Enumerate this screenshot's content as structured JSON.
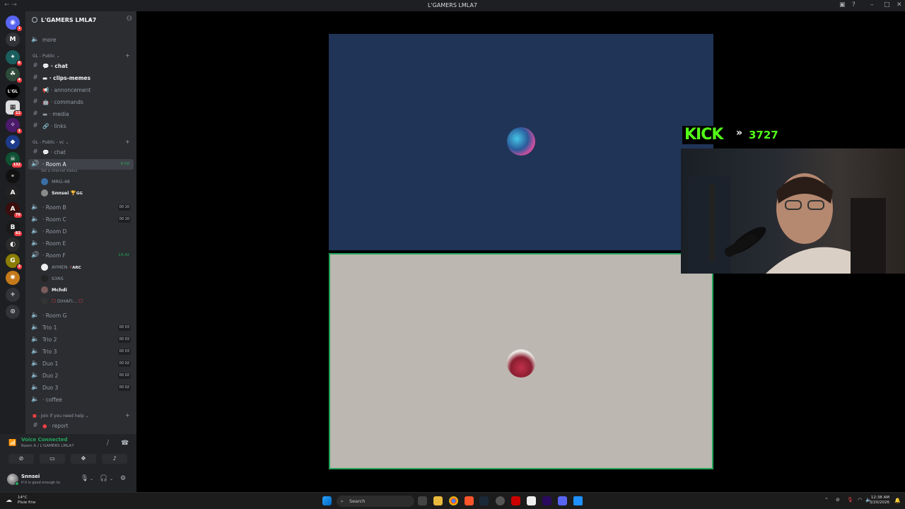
{
  "window": {
    "title": "L'GAMERS LMLA7"
  },
  "server": {
    "name": "L'GAMERS LMLA7"
  },
  "channels_top": [
    {
      "name": "more",
      "type": "voice"
    }
  ],
  "categories": [
    {
      "name": "GL - Public"
    },
    {
      "name": "GL - Public - vc"
    },
    {
      "name": "join if you need help"
    }
  ],
  "text_channels": [
    {
      "name": "chat",
      "emoji": "💬"
    },
    {
      "name": "clips-memes",
      "emoji": "▬"
    },
    {
      "name": "annoncement",
      "emoji": "📢"
    },
    {
      "name": "commands",
      "emoji": "🤖"
    },
    {
      "name": "media",
      "emoji": "▬"
    },
    {
      "name": "links",
      "emoji": "🔗"
    }
  ],
  "vc_channels": {
    "chat": "chat",
    "room_a": {
      "name": "Room A",
      "timer": "6:56",
      "status_hint": "Set a channel status"
    },
    "room_a_members": [
      {
        "name": "MRG-48"
      },
      {
        "name": "Snnsei",
        "tag": "GG"
      }
    ],
    "rooms": [
      {
        "name": "Room B",
        "count": "00 10"
      },
      {
        "name": "Room C",
        "count": "00 10"
      },
      {
        "name": "Room D"
      },
      {
        "name": "Room E"
      }
    ],
    "room_f": {
      "name": "Room F",
      "timer": "19:42"
    },
    "room_f_members": [
      {
        "name": "AYMEN",
        "tag": "ARC"
      },
      {
        "name": "ILYAS"
      },
      {
        "name": "Mchdi"
      },
      {
        "name": "DIHAFI..."
      }
    ],
    "room_g": "Room G",
    "trios": [
      {
        "name": "Trio 1",
        "count": "00 03"
      },
      {
        "name": "Trio 2",
        "count": "00 03"
      },
      {
        "name": "Trio 3",
        "count": "00 03"
      },
      {
        "name": "Duo 1",
        "count": "00 02"
      },
      {
        "name": "Duo 2",
        "count": "00 02"
      },
      {
        "name": "Duo 3",
        "count": "00 02"
      }
    ],
    "coffee": "coffee"
  },
  "help": {
    "report": "report"
  },
  "voice": {
    "status": "Voice Connected",
    "location": "Room A / L'GAMERS LMLA7"
  },
  "user": {
    "name": "Snnsei",
    "status": "If it is good enough to"
  },
  "overlay": {
    "kick_logo": "KICK",
    "kick_arrow": "»",
    "followers": "3727"
  },
  "taskbar": {
    "weather_temp": "14°C",
    "weather_desc": "Pluie fine",
    "search": "Search",
    "time": "12:38 AM",
    "date": "3/20/2026"
  },
  "guild_badges": [
    "1",
    "6",
    "4",
    "12",
    "1",
    "132",
    "76",
    "62",
    "3",
    "3"
  ],
  "guild_labels": [
    "M",
    "L'GL"
  ],
  "colors": {
    "tile_top": "#203457",
    "tile_bottom": "#bcb7b0",
    "speaking": "#23a55a",
    "kick_green": "#53fc18"
  }
}
